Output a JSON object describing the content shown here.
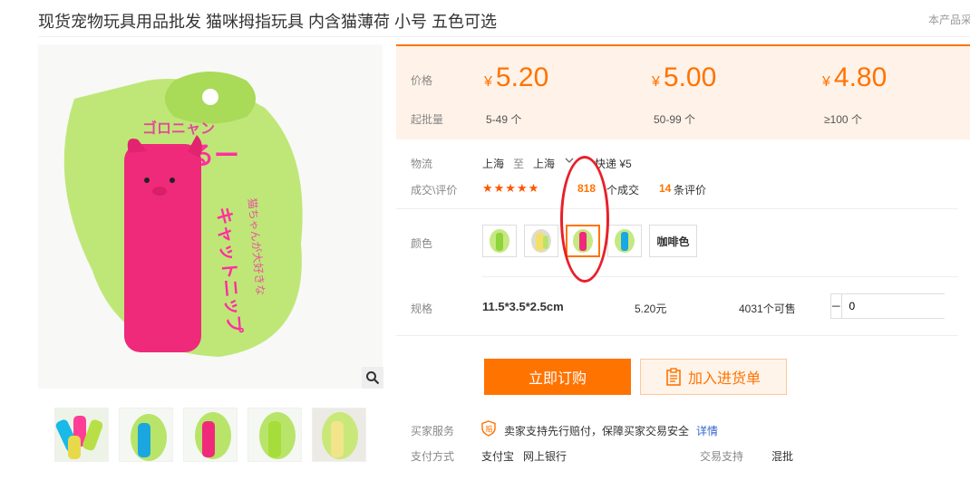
{
  "product": {
    "title": "现货宠物玩具用品批发 猫咪拇指玩具 内含猫薄荷 小号 五色可选",
    "report_text": "本产品采"
  },
  "price_panel": {
    "price_label": "价格",
    "moq_label": "起批量",
    "currency": "¥",
    "tiers": [
      {
        "price": "5.20",
        "range": "5-49 个"
      },
      {
        "price": "5.00",
        "range": "50-99 个"
      },
      {
        "price": "4.80",
        "range": "≥100 个"
      }
    ]
  },
  "logistics": {
    "label": "物流",
    "from": "上海",
    "to_word": "至",
    "to": "上海",
    "method": "快递 ¥5"
  },
  "deals": {
    "label": "成交\\评价",
    "stars": "★★★★★",
    "count": "818",
    "count_suffix": "个成交",
    "reviews": "14",
    "reviews_suffix": "条评价"
  },
  "color": {
    "label": "颜色",
    "text_option": "咖啡色"
  },
  "spec": {
    "label": "规格",
    "name": "11.5*3.5*2.5cm",
    "price": "5.20元",
    "stock": "4031个可售",
    "quantity": "0",
    "minus": "−",
    "plus": "+"
  },
  "actions": {
    "buy": "立即订购",
    "cart": "加入进货单"
  },
  "services": {
    "label": "买家服务",
    "text": "卖家支持先行赔付，保障买家交易安全",
    "details_link": "详情"
  },
  "payment": {
    "label": "支付方式",
    "methods": [
      "支付宝",
      "网上银行"
    ],
    "trade_label": "交易支持",
    "trade_value": "混批"
  },
  "colors": {
    "accent": "#ff7300",
    "price_bg": "#fff2e8",
    "annotation": "#e8202a"
  }
}
